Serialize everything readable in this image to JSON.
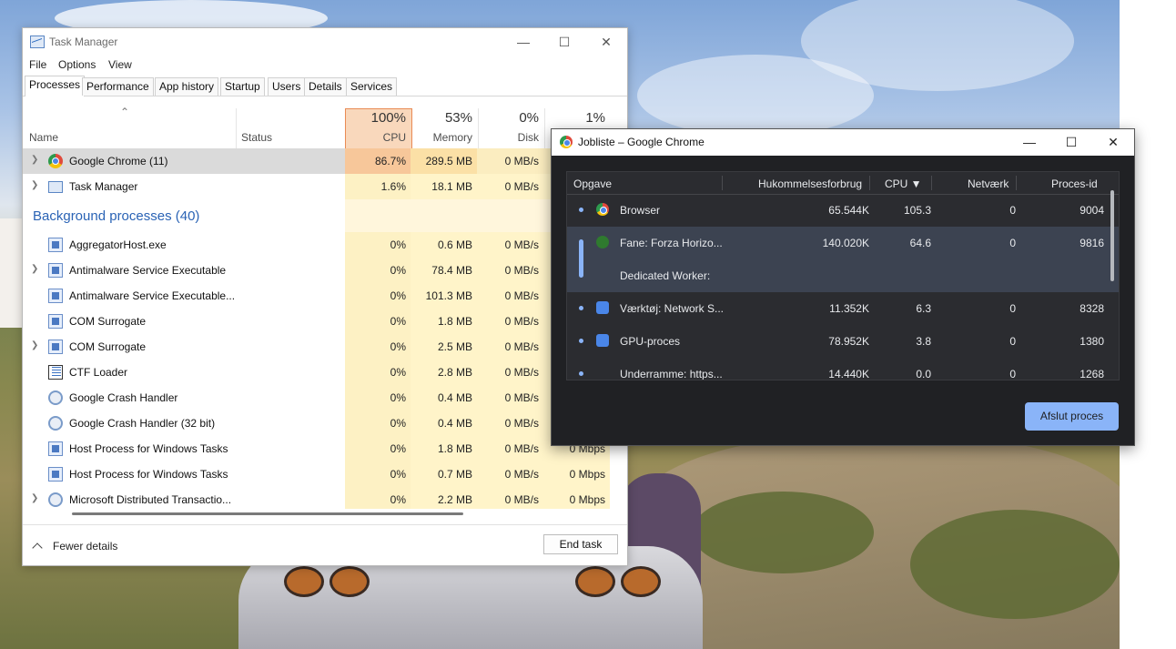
{
  "task_manager": {
    "title": "Task Manager",
    "menu": [
      "File",
      "Options",
      "View"
    ],
    "tabs": [
      "Processes",
      "Performance",
      "App history",
      "Startup",
      "Users",
      "Details",
      "Services"
    ],
    "columns": {
      "name": "Name",
      "status": "Status",
      "cpu_pct": "100%",
      "cpu": "CPU",
      "memory_pct": "53%",
      "memory": "Memory",
      "disk_pct": "0%",
      "disk": "Disk",
      "network_pct": "1%"
    },
    "apps": [
      {
        "name": "Google Chrome (11)",
        "cpu": "86.7%",
        "memory": "289.5 MB",
        "disk": "0 MB/s",
        "icon": "chrome-icon"
      },
      {
        "name": "Task Manager",
        "cpu": "1.6%",
        "memory": "18.1 MB",
        "disk": "0 MB/s",
        "icon": "task-manager-icon"
      }
    ],
    "group_label": "Background processes (40)",
    "background": [
      {
        "name": "AggregatorHost.exe",
        "cpu": "0%",
        "memory": "0.6 MB",
        "disk": "0 MB/s",
        "network": "",
        "expandable": false,
        "icon": "service-icon"
      },
      {
        "name": "Antimalware Service Executable",
        "cpu": "0%",
        "memory": "78.4 MB",
        "disk": "0 MB/s",
        "network": "",
        "expandable": true,
        "icon": "service-icon"
      },
      {
        "name": "Antimalware Service Executable...",
        "cpu": "0%",
        "memory": "101.3 MB",
        "disk": "0 MB/s",
        "network": "",
        "expandable": false,
        "icon": "service-icon"
      },
      {
        "name": "COM Surrogate",
        "cpu": "0%",
        "memory": "1.8 MB",
        "disk": "0 MB/s",
        "network": "",
        "expandable": false,
        "icon": "service-icon"
      },
      {
        "name": "COM Surrogate",
        "cpu": "0%",
        "memory": "2.5 MB",
        "disk": "0 MB/s",
        "network": "",
        "expandable": true,
        "icon": "service-icon"
      },
      {
        "name": "CTF Loader",
        "cpu": "0%",
        "memory": "2.8 MB",
        "disk": "0 MB/s",
        "network": "",
        "expandable": false,
        "icon": "notepad-icon"
      },
      {
        "name": "Google Crash Handler",
        "cpu": "0%",
        "memory": "0.4 MB",
        "disk": "0 MB/s",
        "network": "",
        "expandable": false,
        "icon": "gear-icon"
      },
      {
        "name": "Google Crash Handler (32 bit)",
        "cpu": "0%",
        "memory": "0.4 MB",
        "disk": "0 MB/s",
        "network": "",
        "expandable": false,
        "icon": "gear-icon"
      },
      {
        "name": "Host Process for Windows Tasks",
        "cpu": "0%",
        "memory": "1.8 MB",
        "disk": "0 MB/s",
        "network": "0 Mbps",
        "expandable": false,
        "icon": "service-icon"
      },
      {
        "name": "Host Process for Windows Tasks",
        "cpu": "0%",
        "memory": "0.7 MB",
        "disk": "0 MB/s",
        "network": "0 Mbps",
        "expandable": false,
        "icon": "service-icon"
      },
      {
        "name": "Microsoft Distributed Transactio...",
        "cpu": "0%",
        "memory": "2.2 MB",
        "disk": "0 MB/s",
        "network": "0 Mbps",
        "expandable": true,
        "icon": "gear-icon"
      }
    ],
    "fewer_details": "Fewer details",
    "end_task": "End task"
  },
  "chrome_tm": {
    "title": "Jobliste – Google Chrome",
    "columns": [
      "Opgave",
      "Hukommelsesforbrug",
      "CPU ▼",
      "Netværk",
      "Proces-id"
    ],
    "rows": [
      {
        "name": "Browser",
        "memory": "65.544K",
        "cpu": "105.3",
        "network": "0",
        "pid": "9004",
        "icon": "chrome-icon"
      },
      {
        "name": "Fane: Forza Horizo...",
        "memory": "140.020K",
        "cpu": "64.6",
        "network": "0",
        "pid": "9816",
        "icon": "xbox-icon",
        "sub": "Dedicated Worker:"
      },
      {
        "name": "Værktøj: Network S...",
        "memory": "11.352K",
        "cpu": "6.3",
        "network": "0",
        "pid": "8328",
        "icon": "puzzle-icon"
      },
      {
        "name": "GPU-proces",
        "memory": "78.952K",
        "cpu": "3.8",
        "network": "0",
        "pid": "1380",
        "icon": "puzzle-icon"
      },
      {
        "name": "Underramme: https...",
        "memory": "14.440K",
        "cpu": "0.0",
        "network": "0",
        "pid": "1268",
        "icon": ""
      }
    ],
    "end_process": "Afslut proces"
  }
}
